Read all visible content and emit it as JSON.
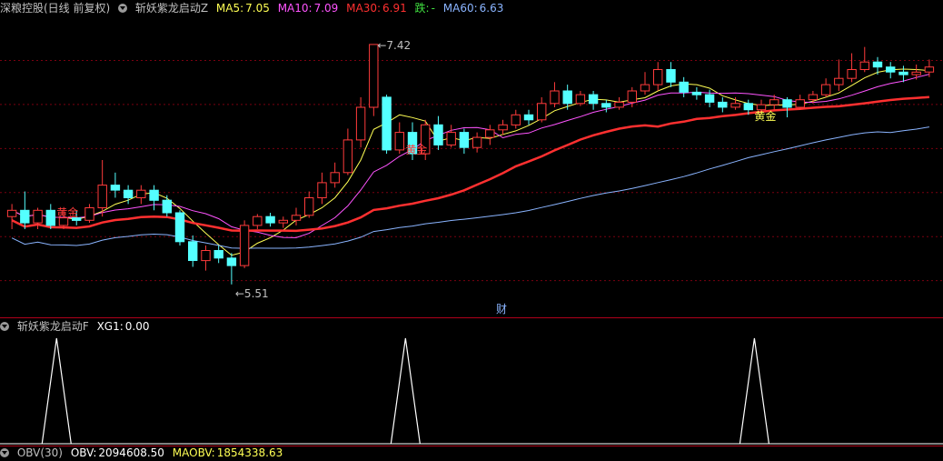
{
  "header": {
    "stock_title": "深粮控股(日线 前复权)",
    "indicator_name": "斩妖紫龙启动Z",
    "ma5_label": "MA5:",
    "ma5_value": "7.05",
    "ma10_label": "MA10:",
    "ma10_value": "7.09",
    "ma30_label": "MA30:",
    "ma30_value": "6.91",
    "die_label": "跌:",
    "die_value": "-",
    "ma60_label": "MA60:",
    "ma60_value": "6.63",
    "colors": {
      "ma5": "#ffff54",
      "ma10": "#ff54ff",
      "ma30": "#ff3030",
      "die": "#40e040",
      "ma60": "#8ab4ff",
      "up": "#ff3b3b",
      "down": "#54ffff"
    }
  },
  "main_chart": {
    "high_label": "7.42",
    "low_label": "5.51",
    "signal_labels": [
      "黄金",
      "黄金",
      "黄金"
    ],
    "cai_label": "财"
  },
  "sub_indicator": {
    "name": "斩妖紫龙启动F",
    "xg_label": "XG1:",
    "xg_value": "0.00"
  },
  "bottom": {
    "name": "OBV(30)",
    "obv_label": "OBV:",
    "obv_value": "2094608.50",
    "maobv_label": "MAOBV:",
    "maobv_value": "1854338.63"
  },
  "chart_data": {
    "type": "candlestick",
    "high": 7.42,
    "low": 5.51,
    "ylim": [
      5.4,
      7.6
    ],
    "candles": [
      [
        6.05,
        6.1,
        6.15,
        5.95
      ],
      [
        6.1,
        6.0,
        6.25,
        5.95
      ],
      [
        6.0,
        6.1,
        6.12,
        5.95
      ],
      [
        6.1,
        5.98,
        6.15,
        5.95
      ],
      [
        5.98,
        6.04,
        6.1,
        5.95
      ],
      [
        6.04,
        6.02,
        6.1,
        5.98
      ],
      [
        6.02,
        6.12,
        6.15,
        6.0
      ],
      [
        6.12,
        6.3,
        6.5,
        6.05
      ],
      [
        6.3,
        6.26,
        6.4,
        6.2
      ],
      [
        6.26,
        6.2,
        6.3,
        6.15
      ],
      [
        6.2,
        6.26,
        6.3,
        6.15
      ],
      [
        6.26,
        6.18,
        6.3,
        6.1
      ],
      [
        6.18,
        6.08,
        6.22,
        6.05
      ],
      [
        6.08,
        5.85,
        6.1,
        5.82
      ],
      [
        5.85,
        5.7,
        5.9,
        5.65
      ],
      [
        5.7,
        5.78,
        5.82,
        5.62
      ],
      [
        5.78,
        5.72,
        5.82,
        5.68
      ],
      [
        5.72,
        5.66,
        5.76,
        5.51
      ],
      [
        5.66,
        5.98,
        6.02,
        5.64
      ],
      [
        5.98,
        6.05,
        6.07,
        5.95
      ],
      [
        6.05,
        6.0,
        6.08,
        5.97
      ],
      [
        6.0,
        6.02,
        6.05,
        5.96
      ],
      [
        6.02,
        6.06,
        6.12,
        5.98
      ],
      [
        6.06,
        6.2,
        6.25,
        6.04
      ],
      [
        6.2,
        6.32,
        6.4,
        6.15
      ],
      [
        6.32,
        6.4,
        6.48,
        6.28
      ],
      [
        6.4,
        6.66,
        6.75,
        6.38
      ],
      [
        6.66,
        6.92,
        7.0,
        6.6
      ],
      [
        6.92,
        7.42,
        7.42,
        6.85
      ],
      [
        7.0,
        6.58,
        7.02,
        6.55
      ],
      [
        6.58,
        6.72,
        6.8,
        6.55
      ],
      [
        6.72,
        6.55,
        6.8,
        6.5
      ],
      [
        6.55,
        6.78,
        6.82,
        6.5
      ],
      [
        6.78,
        6.62,
        6.85,
        6.58
      ],
      [
        6.62,
        6.72,
        6.78,
        6.6
      ],
      [
        6.72,
        6.6,
        6.75,
        6.55
      ],
      [
        6.6,
        6.68,
        6.72,
        6.56
      ],
      [
        6.68,
        6.74,
        6.78,
        6.62
      ],
      [
        6.74,
        6.78,
        6.82,
        6.7
      ],
      [
        6.78,
        6.86,
        6.9,
        6.75
      ],
      [
        6.86,
        6.82,
        6.9,
        6.78
      ],
      [
        6.82,
        6.95,
        7.0,
        6.8
      ],
      [
        6.95,
        7.05,
        7.12,
        6.92
      ],
      [
        7.05,
        6.95,
        7.1,
        6.9
      ],
      [
        6.95,
        7.02,
        7.05,
        6.93
      ],
      [
        7.02,
        6.95,
        7.05,
        6.9
      ],
      [
        6.95,
        6.92,
        6.98,
        6.88
      ],
      [
        6.92,
        6.96,
        7.0,
        6.9
      ],
      [
        6.96,
        7.05,
        7.08,
        6.92
      ],
      [
        7.05,
        7.1,
        7.2,
        7.02
      ],
      [
        7.1,
        7.22,
        7.28,
        7.05
      ],
      [
        7.22,
        7.12,
        7.28,
        7.08
      ],
      [
        7.12,
        7.04,
        7.16,
        7.0
      ],
      [
        7.04,
        7.02,
        7.08,
        6.98
      ],
      [
        7.02,
        6.96,
        7.06,
        6.92
      ],
      [
        6.96,
        6.92,
        7.0,
        6.88
      ],
      [
        6.92,
        6.95,
        7.0,
        6.9
      ],
      [
        6.95,
        6.9,
        6.98,
        6.86
      ],
      [
        6.9,
        6.94,
        6.98,
        6.88
      ],
      [
        6.94,
        6.98,
        7.02,
        6.9
      ],
      [
        6.98,
        6.92,
        7.0,
        6.84
      ],
      [
        6.92,
        6.98,
        7.02,
        6.9
      ],
      [
        6.98,
        7.02,
        7.05,
        6.95
      ],
      [
        7.02,
        7.1,
        7.15,
        7.0
      ],
      [
        7.1,
        7.15,
        7.3,
        7.05
      ],
      [
        7.15,
        7.22,
        7.35,
        7.12
      ],
      [
        7.22,
        7.28,
        7.4,
        7.2
      ],
      [
        7.28,
        7.24,
        7.32,
        7.18
      ],
      [
        7.24,
        7.2,
        7.28,
        7.15
      ],
      [
        7.2,
        7.18,
        7.25,
        7.12
      ],
      [
        7.18,
        7.2,
        7.26,
        7.14
      ],
      [
        7.2,
        7.24,
        7.3,
        7.16
      ]
    ],
    "ma5": [],
    "ma10": [],
    "ma30": [],
    "ma60": [],
    "signal_peaks": [
      0.06,
      0.43,
      0.8
    ]
  }
}
